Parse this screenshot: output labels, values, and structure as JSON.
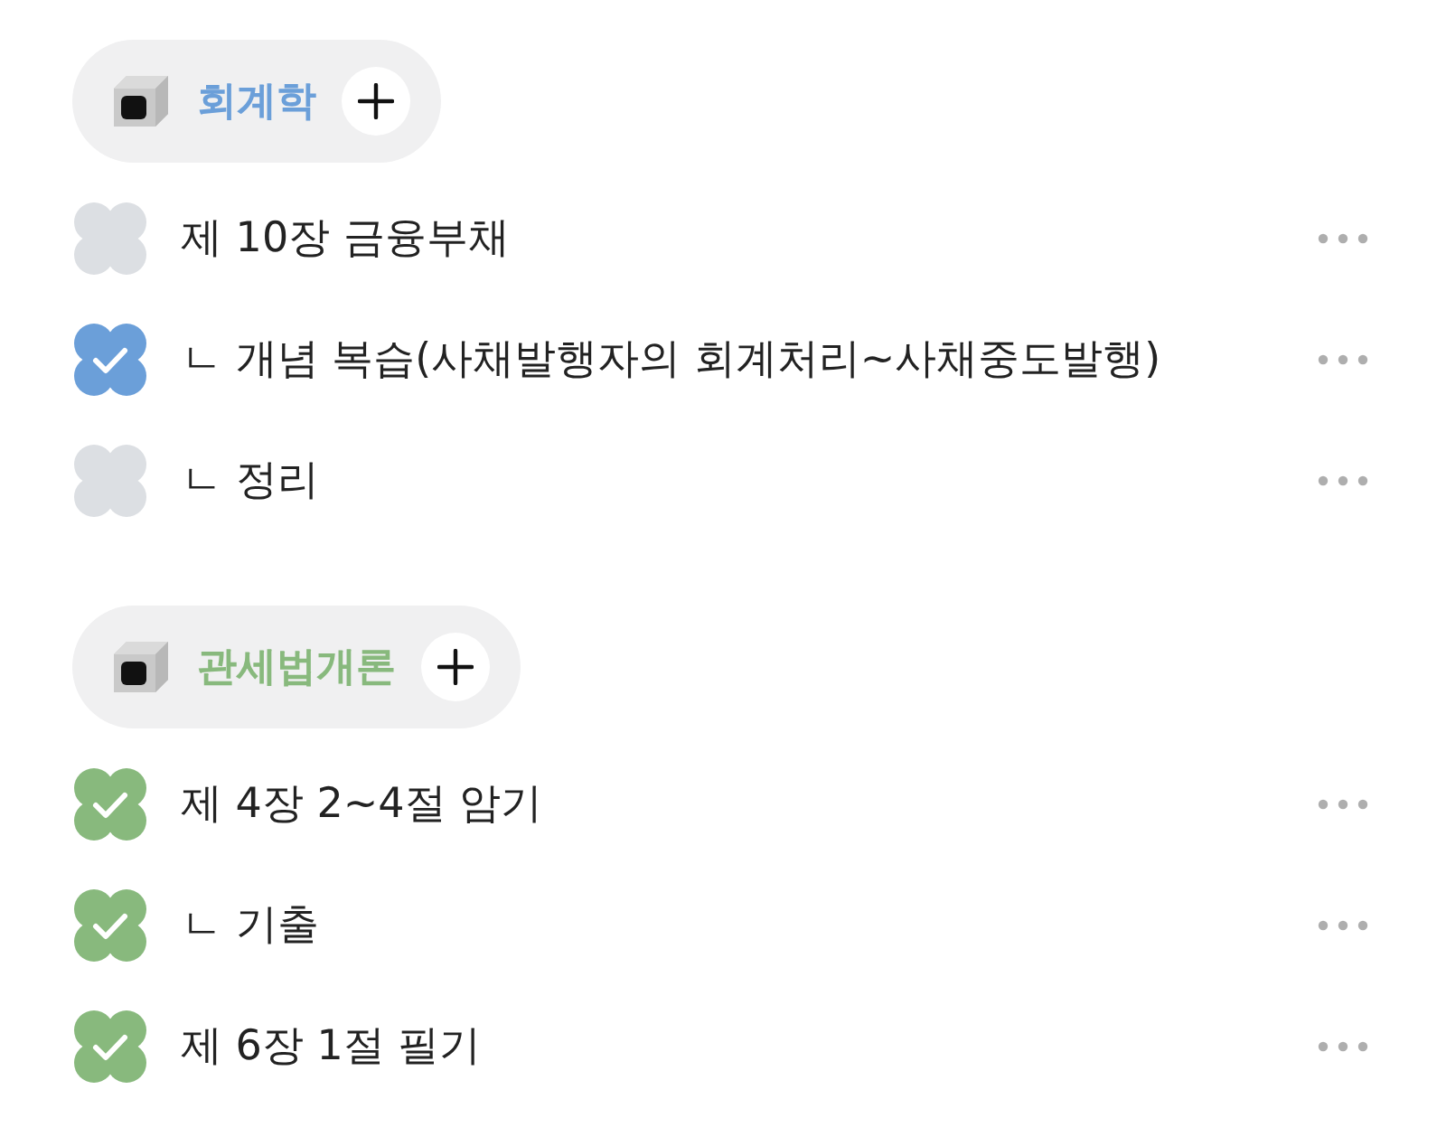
{
  "categories": [
    {
      "title": "회계학",
      "color": "#6b9fd9",
      "items": [
        {
          "text": "제 10장 금융부채",
          "checked": false
        },
        {
          "text": "ㄴ 개념 복습(사채발행자의 회계처리~사채중도발행)",
          "checked": true
        },
        {
          "text": "ㄴ 정리",
          "checked": false
        }
      ]
    },
    {
      "title": "관세법개론",
      "color": "#88b97d",
      "items": [
        {
          "text": "제 4장 2~4절 암기",
          "checked": true
        },
        {
          "text": "ㄴ 기출",
          "checked": true
        },
        {
          "text": "제 6장 1절 필기",
          "checked": true
        }
      ]
    }
  ]
}
